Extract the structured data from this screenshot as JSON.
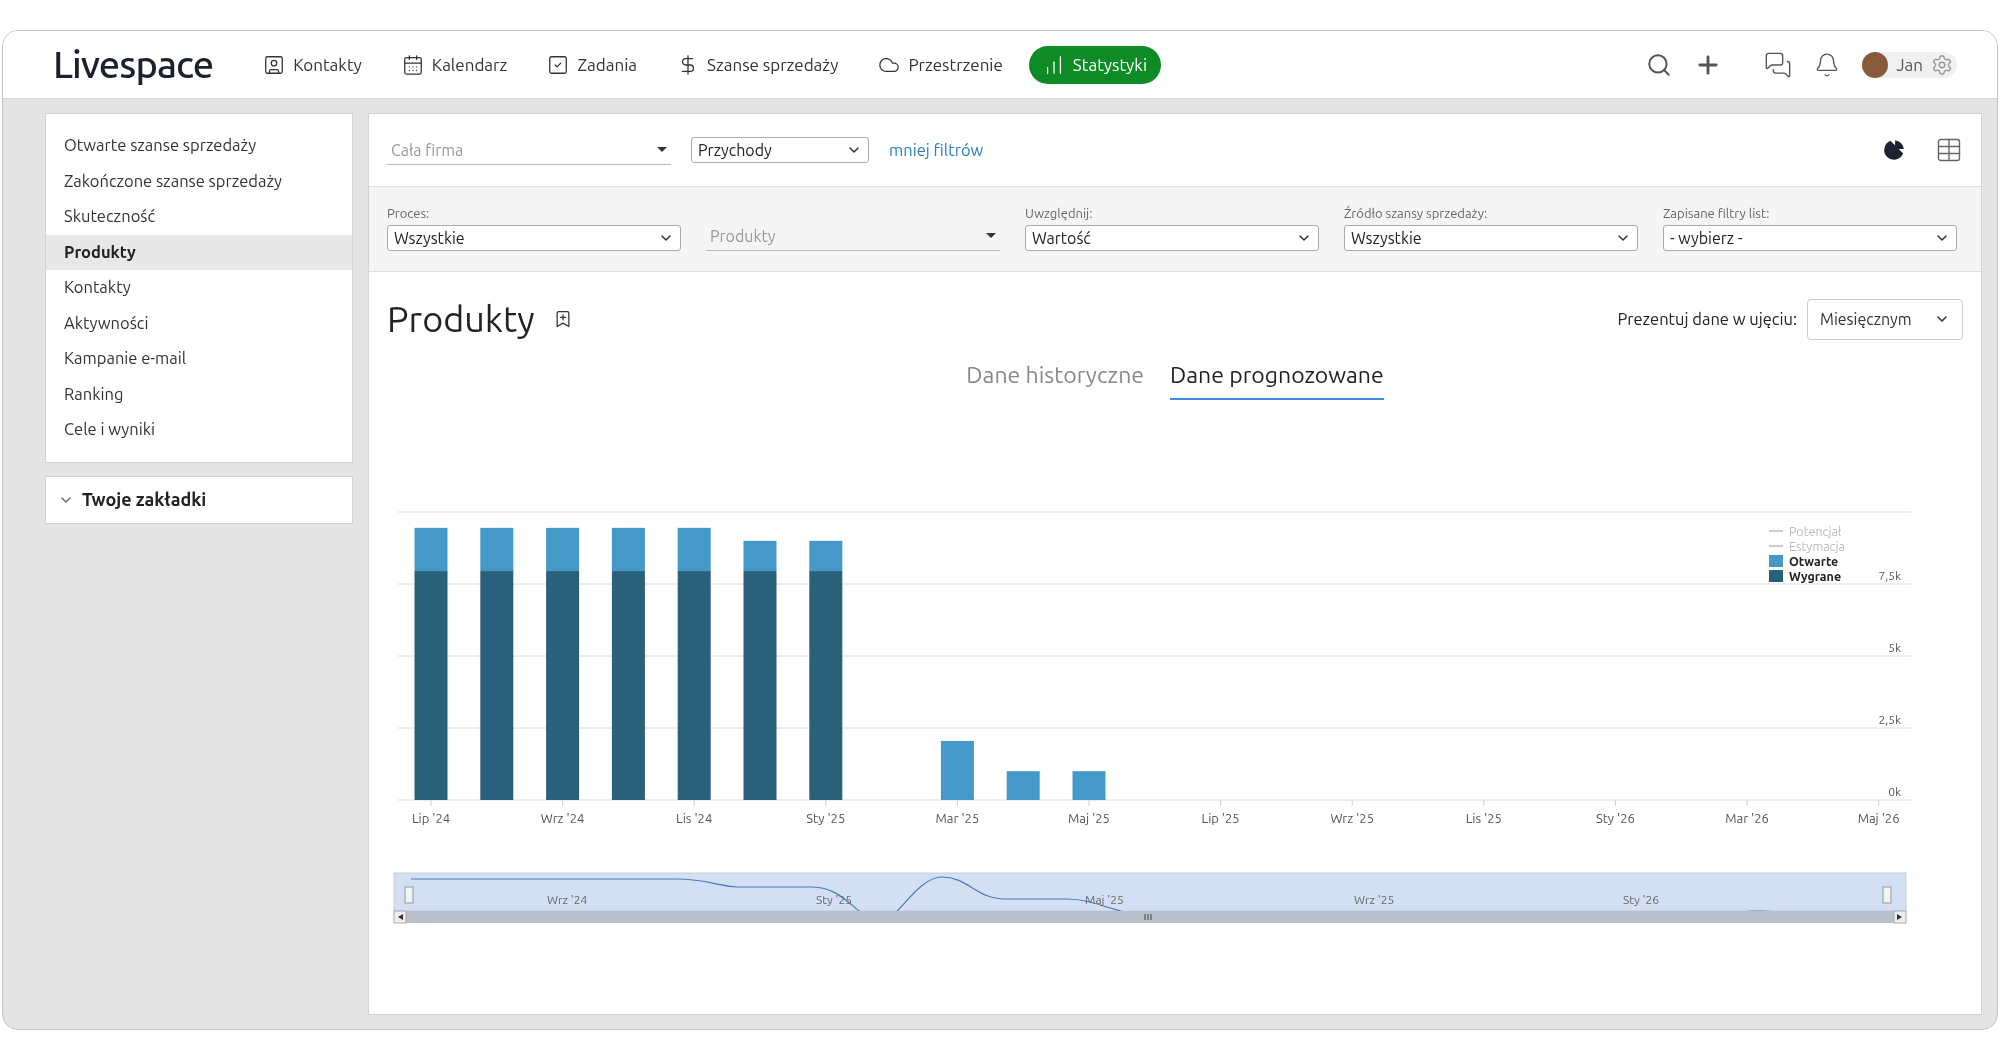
{
  "app": {
    "logo": "Livespace"
  },
  "nav": [
    {
      "label": "Kontakty",
      "selected": false
    },
    {
      "label": "Kalendarz",
      "selected": false
    },
    {
      "label": "Zadania",
      "selected": false
    },
    {
      "label": "Szanse sprzedaży",
      "selected": false
    },
    {
      "label": "Przestrzenie",
      "selected": false
    },
    {
      "label": "Statystyki",
      "selected": true
    }
  ],
  "user": {
    "name": "Jan"
  },
  "sidebar": {
    "items": [
      {
        "label": "Otwarte szanse sprzedaży",
        "selected": false
      },
      {
        "label": "Zakończone szanse sprzedaży",
        "selected": false
      },
      {
        "label": "Skuteczność",
        "selected": false
      },
      {
        "label": "Produkty",
        "selected": true
      },
      {
        "label": "Kontakty",
        "selected": false
      },
      {
        "label": "Aktywności",
        "selected": false
      },
      {
        "label": "Kampanie e-mail",
        "selected": false
      },
      {
        "label": "Ranking",
        "selected": false
      },
      {
        "label": "Cele i wyniki",
        "selected": false
      }
    ],
    "bookmarks": {
      "title": "Twoje zakładki",
      "expanded": false
    }
  },
  "top_filters": [
    {
      "kind": "underline",
      "placeholder": "Cała firma"
    },
    {
      "kind": "select",
      "value": "Przychody"
    }
  ],
  "less_filters_link": "mniej filtrów",
  "filters": [
    {
      "label": "Proces:",
      "kind": "select",
      "value": "Wszystkie"
    },
    {
      "kind": "underline",
      "placeholder": "Produkty"
    },
    {
      "label": "Uwzględnij:",
      "kind": "select",
      "value": "Wartość"
    },
    {
      "label": "Źródło szansy sprzedaży:",
      "kind": "select",
      "value": "Wszystkie"
    },
    {
      "label": "Zapisane filtry list:",
      "kind": "select",
      "value": "- wybierz -"
    }
  ],
  "report": {
    "title": "Produkty",
    "period_label": "Prezentuj dane w ujęciu:",
    "period_value": "Miesięcznym"
  },
  "tabs": [
    {
      "label": "Dane historyczne",
      "selected": false
    },
    {
      "label": "Dane prognozowane",
      "selected": true
    }
  ],
  "legend_hidden": [
    {
      "label": "Potencjał",
      "disabled": true
    },
    {
      "label": "Estymacja",
      "disabled": true
    }
  ],
  "chart_data": {
    "type": "bar",
    "stacked": true,
    "grid": true,
    "legend": "right",
    "categories": [
      "Lip '24",
      null,
      "Wrz '24",
      null,
      "Lis '24",
      null,
      "Sty '25",
      null,
      "Mar '25",
      null,
      "Maj '25",
      null,
      "Lip '25",
      null,
      "Wrz '25",
      null,
      "Lis '25",
      null,
      "Sty '26",
      null,
      "Mar '26",
      null,
      "Maj '26"
    ],
    "ylim": [
      0,
      10000
    ],
    "yticks": [
      {
        "value": 0,
        "label": "0k"
      },
      {
        "value": 2500,
        "label": "2,5k"
      },
      {
        "value": 5000,
        "label": "5k"
      },
      {
        "value": 7500,
        "label": "7,5k"
      }
    ],
    "series": [
      {
        "name": "Wygrane",
        "color": "#2a6079",
        "values": [
          7950,
          7950,
          7950,
          7950,
          7950,
          7950,
          7950,
          null,
          null,
          null,
          null,
          null,
          null,
          null,
          null,
          null,
          null,
          null,
          null,
          null,
          null,
          null,
          null
        ]
      },
      {
        "name": "Otwarte",
        "color": "#4499c8",
        "values": [
          1500,
          1500,
          1500,
          1500,
          1500,
          1050,
          1050,
          null,
          2050,
          1000,
          1000,
          null,
          null,
          null,
          null,
          null,
          null,
          null,
          null,
          null,
          null,
          null,
          null
        ]
      }
    ]
  },
  "navigator": {
    "labels": [
      "Wrz '24",
      "Sty '25",
      "Maj '25",
      "Wrz '25",
      "Sty '26"
    ]
  }
}
